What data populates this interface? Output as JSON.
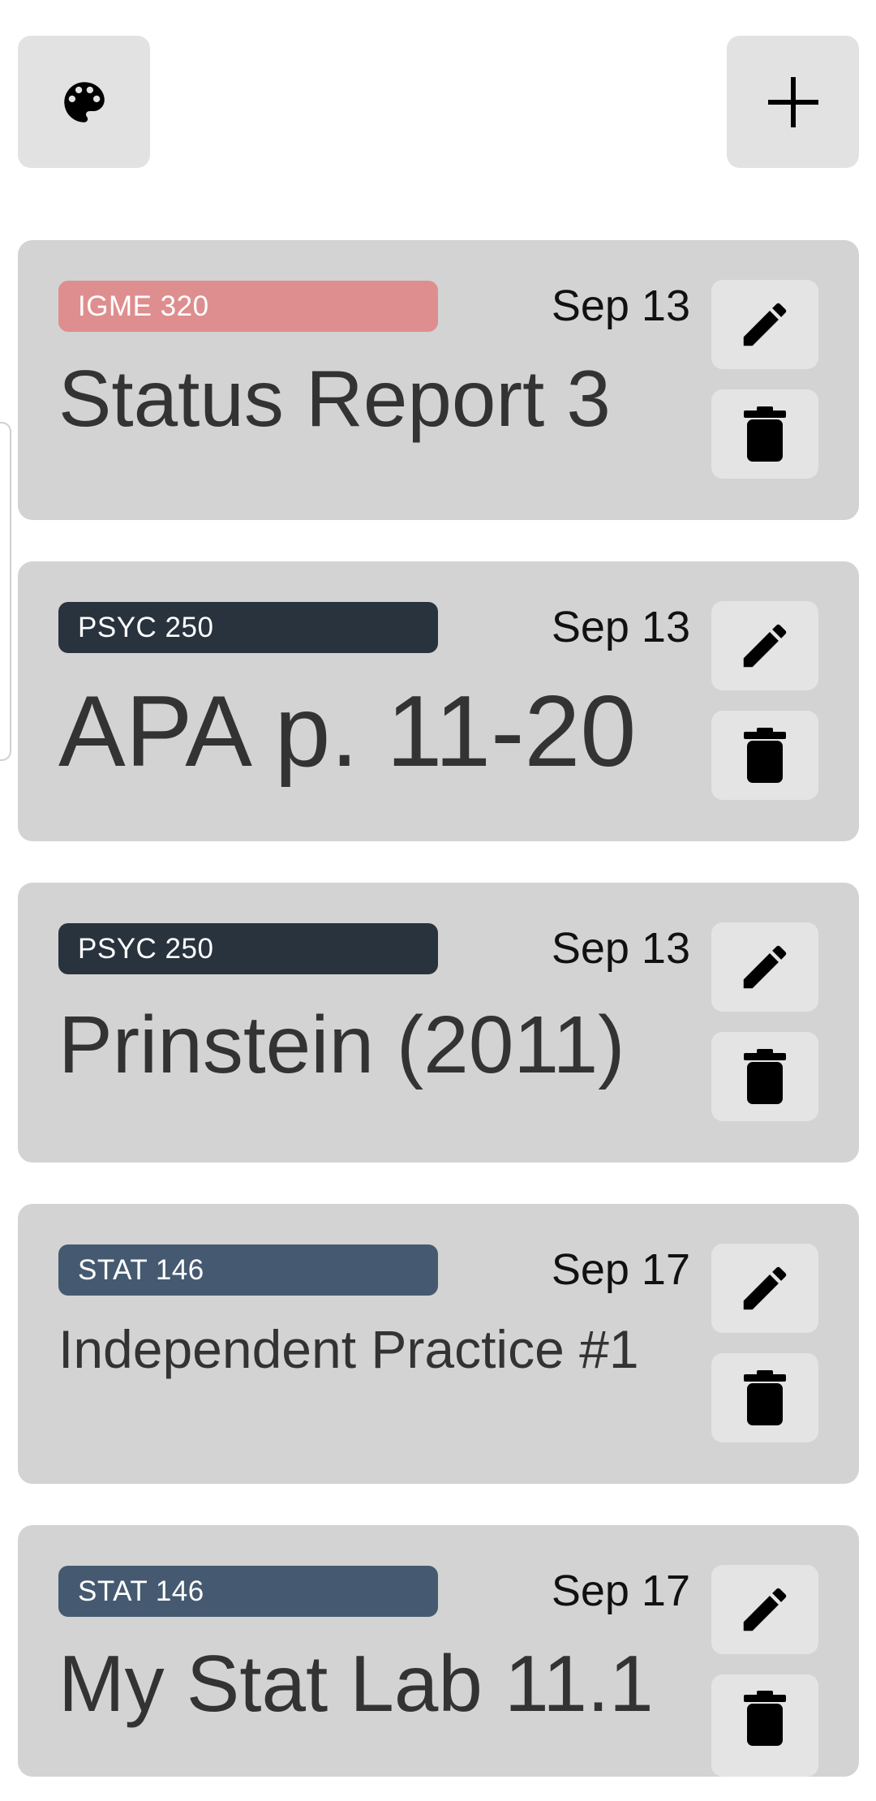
{
  "header": {
    "theme_icon": "palette-icon",
    "add_icon": "plus-icon"
  },
  "colors": {
    "igme": "#de8e8e",
    "psyc": "#28333d",
    "stat": "#455a70",
    "card_bg": "#d3d3d3",
    "button_bg": "#e4e4e4"
  },
  "tasks": [
    {
      "course": "IGME 320",
      "date": "Sep 13",
      "title": "Status Report 3"
    },
    {
      "course": "PSYC 250",
      "date": "Sep 13",
      "title": "APA p. 11-20"
    },
    {
      "course": "PSYC 250",
      "date": "Sep 13",
      "title": "Prinstein (2011)"
    },
    {
      "course": "STAT 146",
      "date": "Sep 17",
      "title": "Independent Practice #1"
    },
    {
      "course": "STAT 146",
      "date": "Sep 17",
      "title": "My Stat Lab 11.1"
    }
  ]
}
